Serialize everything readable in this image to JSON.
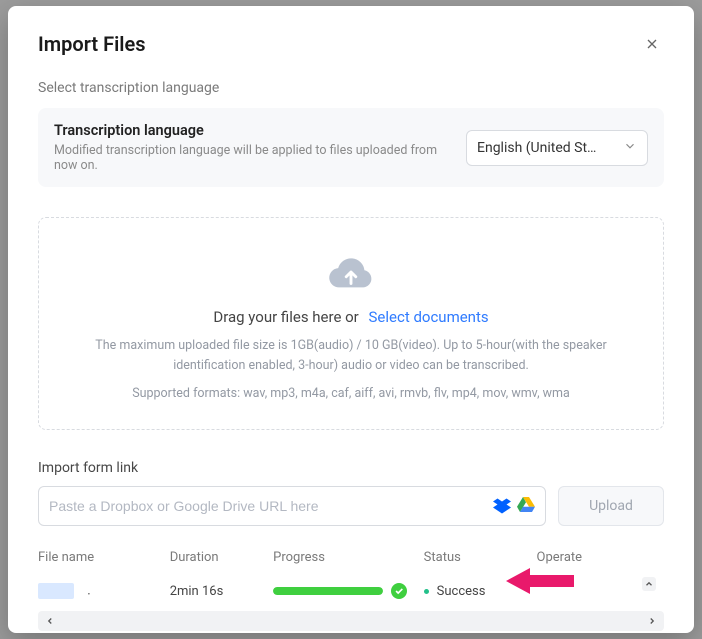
{
  "modal": {
    "title": "Import Files",
    "subhead": "Select transcription language"
  },
  "language_card": {
    "title": "Transcription language",
    "desc": "Modified transcription language will be applied to files uploaded from now on.",
    "select_value": "English (United St…"
  },
  "dropzone": {
    "prompt_prefix": "Drag your files here or",
    "prompt_link": "Select documents",
    "desc": "The maximum uploaded file size is 1GB(audio) / 10 GB(video). Up to 5-hour(with the speaker identification enabled, 3-hour) audio or video can be transcribed.",
    "supported": "Supported formats: wav, mp3, m4a, caf, aiff, avi, rmvb, flv, mp4, mov, wmv, wma"
  },
  "link_import": {
    "label": "Import form link",
    "placeholder": "Paste a Dropbox or Google Drive URL here",
    "upload_btn": "Upload"
  },
  "table": {
    "headers": {
      "filename": "File name",
      "duration": "Duration",
      "progress": "Progress",
      "status": "Status",
      "operate": "Operate"
    },
    "row": {
      "filename_trail": ".",
      "duration": "2min 16s",
      "progress_pct": 100,
      "status": "Success"
    }
  },
  "colors": {
    "accent_link": "#2f7bff",
    "progress_green": "#3fcf3f",
    "status_dot": "#23c08a",
    "annotation_arrow": "#e9196b"
  }
}
